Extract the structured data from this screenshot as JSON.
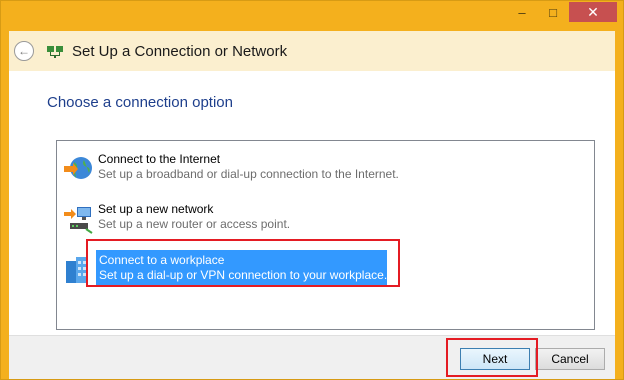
{
  "window": {
    "title": "Set Up a Connection or Network",
    "controls": {
      "minimize": "–",
      "maximize": "□",
      "close": "✕"
    }
  },
  "header": {
    "back_icon": "back-arrow-icon",
    "title": "Set Up a Connection or Network"
  },
  "main": {
    "instruction": "Choose a connection option",
    "options": [
      {
        "title": "Connect to the Internet",
        "description": "Set up a broadband or dial-up connection to the Internet.",
        "icon": "globe-icon",
        "selected": false
      },
      {
        "title": "Set up a new network",
        "description": "Set up a new router or access point.",
        "icon": "router-icon",
        "selected": false
      },
      {
        "title": "Connect to a workplace",
        "description": "Set up a dial-up or VPN connection to your workplace.",
        "icon": "workplace-icon",
        "selected": true
      }
    ]
  },
  "footer": {
    "next_label": "Next",
    "cancel_label": "Cancel"
  },
  "colors": {
    "frame": "#f4b01d",
    "header_bg": "#fbefcf",
    "instruction": "#1e3f8c",
    "selection": "#3399ff",
    "highlight_box": "#e41b23",
    "close_button": "#c75050"
  }
}
